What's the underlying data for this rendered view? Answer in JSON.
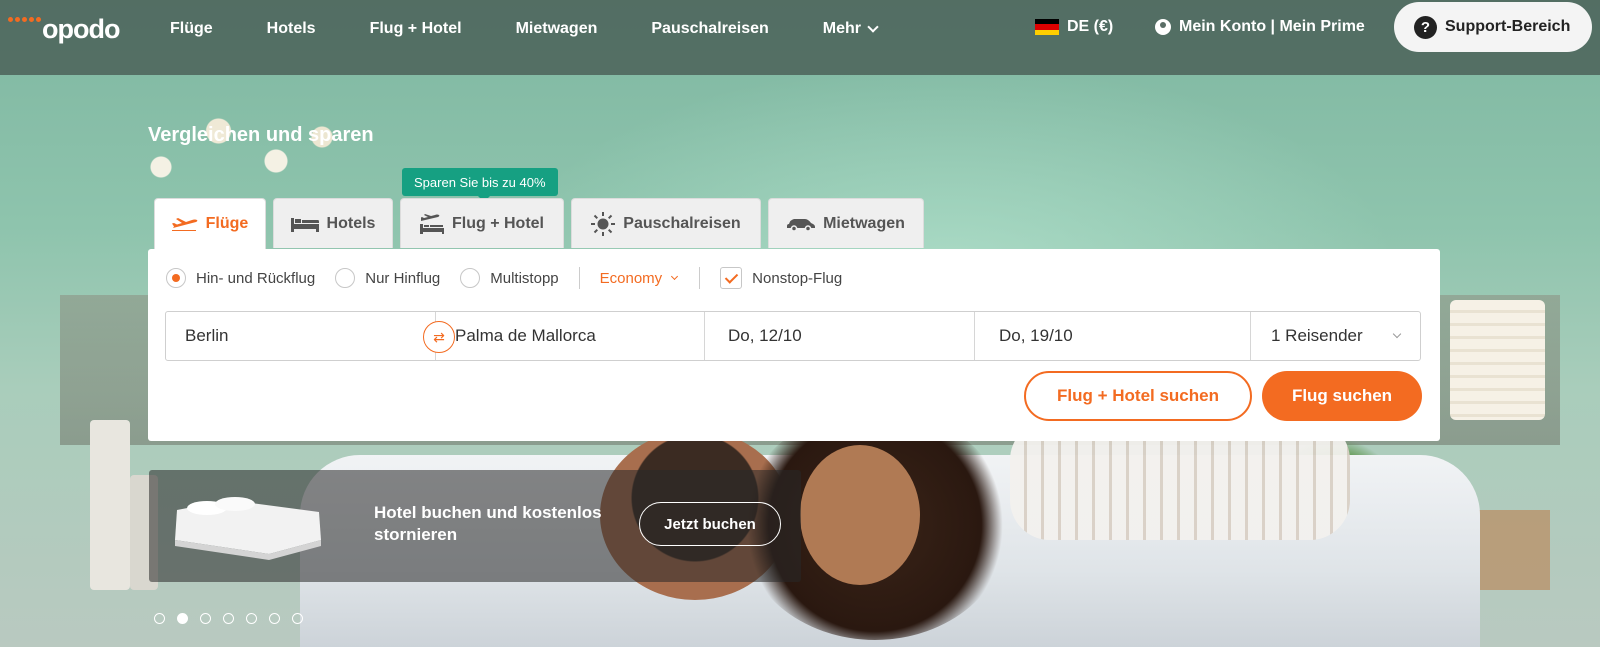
{
  "brand": {
    "logo_text": "opodo",
    "accent": "#f36b21",
    "promo_color": "#16a082"
  },
  "header": {
    "nav": [
      "Flüge",
      "Hotels",
      "Flug + Hotel",
      "Mietwagen",
      "Pauschalreisen",
      "Mehr"
    ],
    "lang": "DE (€)",
    "account": "Mein Konto | Mein Prime",
    "support": "Support-Bereich"
  },
  "search": {
    "tagline": "Vergleichen und sparen",
    "promo_badge": "Sparen Sie bis zu 40%",
    "tabs": [
      {
        "label": "Flüge",
        "icon": "plane-icon",
        "active": true
      },
      {
        "label": "Hotels",
        "icon": "bed-icon",
        "active": false
      },
      {
        "label": "Flug + Hotel",
        "icon": "flight-hotel-icon",
        "active": false
      },
      {
        "label": "Pauschalreisen",
        "icon": "sun-icon",
        "active": false
      },
      {
        "label": "Mietwagen",
        "icon": "car-icon",
        "active": false
      }
    ],
    "trip_types": [
      "Hin- und Rückflug",
      "Nur Hinflug",
      "Multistopp"
    ],
    "cabin": "Economy",
    "nonstop_label": "Nonstop-Flug",
    "nonstop_checked": true,
    "origin": "Berlin",
    "destination": "Palma de Mallorca",
    "depart_date": "Do, 12/10",
    "return_date": "Do, 19/10",
    "travelers": "1 Reisender",
    "btn_flight_hotel": "Flug + Hotel suchen",
    "btn_flight": "Flug suchen"
  },
  "banner": {
    "text": "Hotel buchen und kostenlos stornieren",
    "button": "Jetzt buchen"
  },
  "carousel": {
    "count": 7,
    "active_index": 1
  }
}
